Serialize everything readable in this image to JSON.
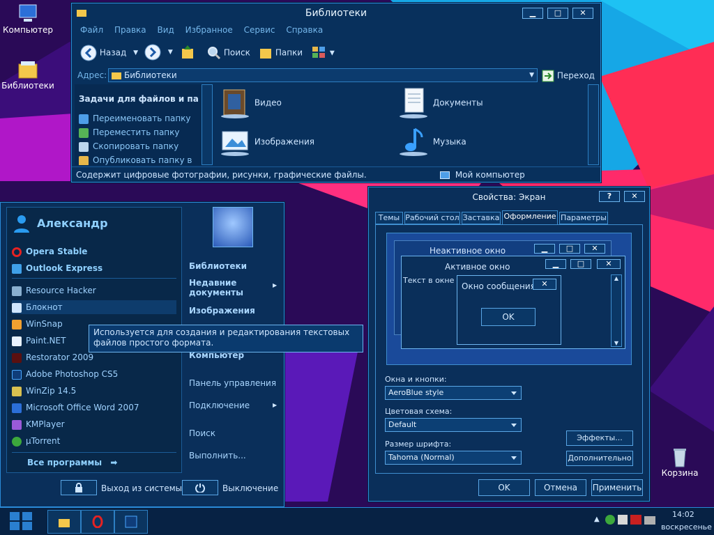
{
  "desktop": {
    "icons": [
      {
        "label": "Компьютер"
      },
      {
        "label": "Библиотеки"
      },
      {
        "label": "Корзина"
      }
    ]
  },
  "explorer": {
    "title": "Библиотеки",
    "menu": [
      "Файл",
      "Правка",
      "Вид",
      "Избранное",
      "Сервис",
      "Справка"
    ],
    "toolbar": {
      "back": "Назад",
      "search": "Поиск",
      "folders": "Папки"
    },
    "address": {
      "label": "Адрес:",
      "value": "Библиотеки",
      "go": "Переход"
    },
    "tasks": {
      "header": "Задачи для файлов и па",
      "items": [
        "Переименовать папку",
        "Переместить папку",
        "Скопировать папку",
        "Опубликовать папку в"
      ]
    },
    "items": [
      "Видео",
      "Документы",
      "Изображения",
      "Музыка"
    ],
    "status": {
      "text": "Содержит цифровые фотографии, рисунки, графические файлы.",
      "location": "Мой компьютер"
    }
  },
  "start_menu": {
    "user": "Александр",
    "pinned": [
      "Opera Stable",
      "Outlook Express"
    ],
    "programs": [
      "Resource Hacker",
      "Блокнот",
      "WinSnap",
      "Paint.NET",
      "Restorator 2009",
      "Adobe Photoshop CS5",
      "WinZip 14.5",
      "Microsoft Office Word 2007",
      "KMPlayer",
      "µTorrent"
    ],
    "all_programs": "Все программы",
    "right": {
      "libraries": "Библиотеки",
      "recent": "Недавние документы",
      "images": "Изображения",
      "computer": "Компьютер",
      "control_panel": "Панель управления",
      "connect": "Подключение",
      "search": "Поиск",
      "run": "Выполнить..."
    },
    "logoff": "Выход из системы",
    "shutdown": "Выключение",
    "tooltip": "Используется для создания и редактирования текстовых файлов простого формата."
  },
  "display_props": {
    "title": "Свойства: Экран",
    "help": "?",
    "tabs": [
      "Темы",
      "Рабочий стол",
      "Заставка",
      "Оформление",
      "Параметры"
    ],
    "preview": {
      "inactive": "Неактивное окно",
      "active": "Активное окно",
      "window_text": "Текст в окне",
      "message_box": "Окно сообщения",
      "ok": "OK"
    },
    "windows_buttons": {
      "label": "Окна и кнопки:",
      "value": "AeroBlue style"
    },
    "color_scheme": {
      "label": "Цветовая схема:",
      "value": "Default"
    },
    "font_size": {
      "label": "Размер шрифта:",
      "value": "Tahoma (Normal)"
    },
    "effects": "Эффекты...",
    "advanced": "Дополнительно",
    "ok": "OK",
    "cancel": "Отмена",
    "apply": "Применить"
  },
  "taskbar": {
    "time": "14:02",
    "day": "воскресенье"
  }
}
